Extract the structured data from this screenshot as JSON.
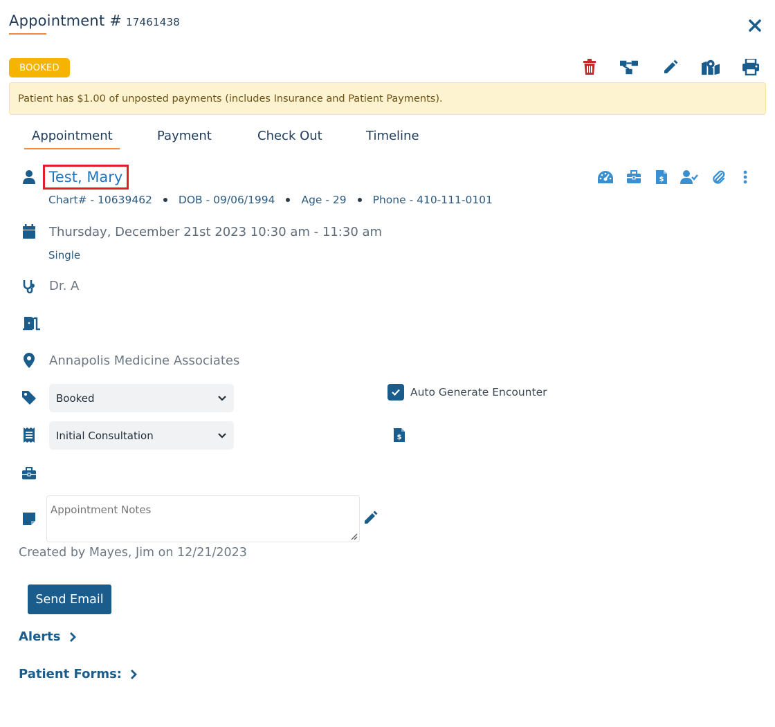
{
  "header": {
    "title": "Appointment #",
    "number": "17461438",
    "status_badge": "BOOKED"
  },
  "alert": {
    "text": "Patient has $1.00 of unposted payments (includes Insurance and Patient Payments)."
  },
  "tabs": [
    {
      "label": "Appointment",
      "active": true
    },
    {
      "label": "Payment",
      "active": false
    },
    {
      "label": "Check Out",
      "active": false
    },
    {
      "label": "Timeline",
      "active": false
    }
  ],
  "patient": {
    "name": "Test, Mary",
    "chart": "Chart# - 10639462",
    "dob": "DOB - 09/06/1994",
    "age": "Age - 29",
    "phone": "Phone - 410-111-0101"
  },
  "appointment": {
    "datetime": "Thursday, December 21st 2023 10:30 am - 11:30 am",
    "recurrence": "Single",
    "provider": "Dr. A",
    "location": "Annapolis Medicine Associates",
    "status_value": "Booked",
    "type_value": "Initial Consultation",
    "auto_generate_label": "Auto Generate Encounter",
    "auto_generate_checked": true,
    "notes_placeholder": "Appointment Notes",
    "created_by": "Created by Mayes, Jim on 12/21/2023"
  },
  "actions": {
    "send_email": "Send Email",
    "alerts": "Alerts",
    "patient_forms": "Patient Forms:"
  },
  "colors": {
    "primary": "#1a5c8c",
    "accent": "#f0883e",
    "badge": "#f5b400",
    "danger": "#c62828",
    "light_icon": "#3a8fd0"
  },
  "icons": {
    "toolbar": [
      "trash-icon",
      "workflow-icon",
      "pencil-icon",
      "map-icon",
      "print-icon"
    ],
    "patient_side": [
      "dashboard-icon",
      "briefcase-icon",
      "invoice-icon",
      "user-check-icon",
      "paperclip-icon",
      "more-vertical-icon"
    ]
  }
}
